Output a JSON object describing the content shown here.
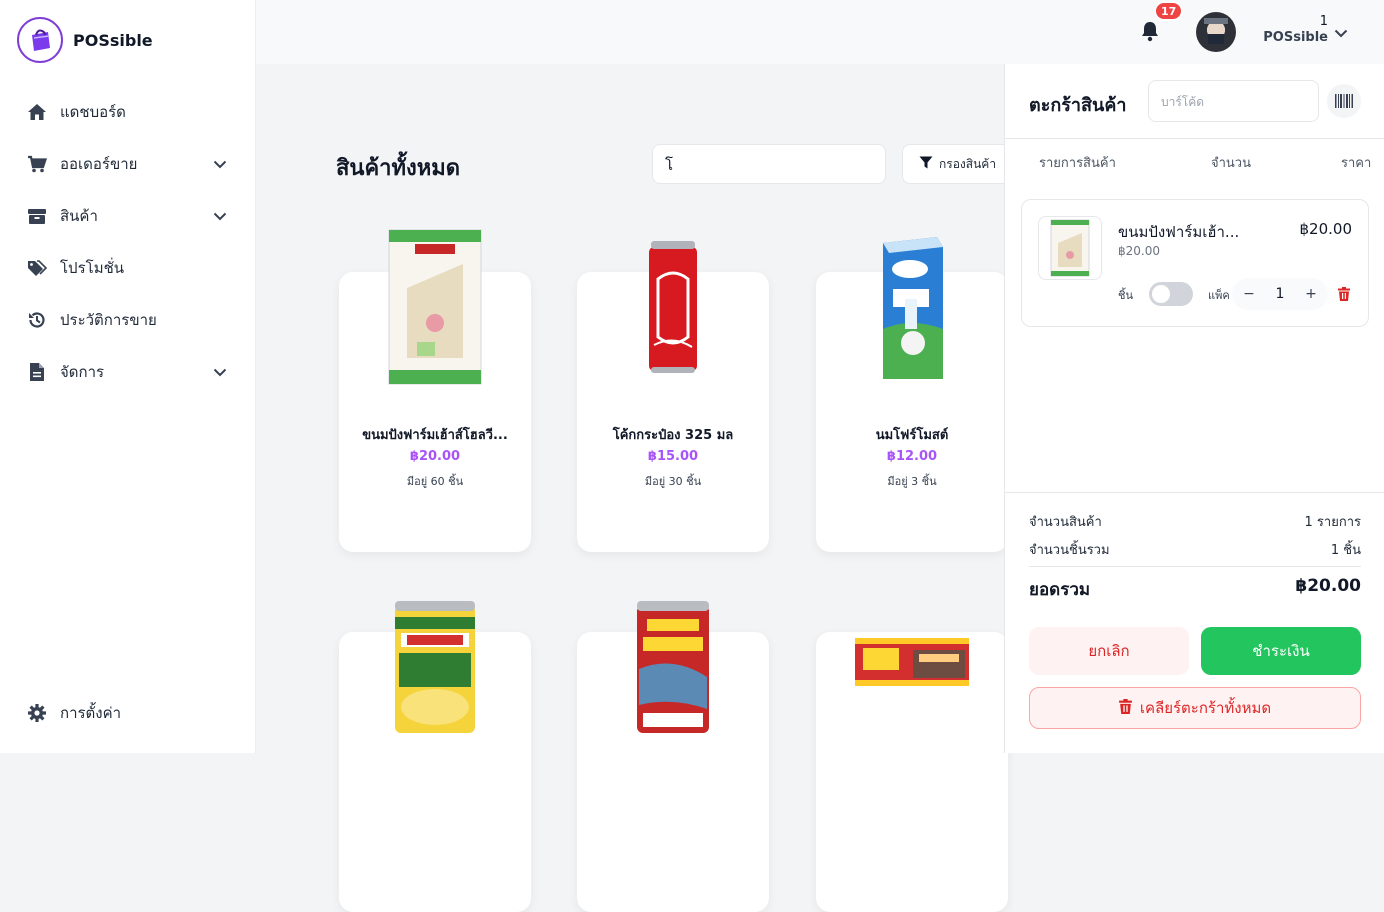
{
  "brand": {
    "name": "POSsible"
  },
  "sidebar": {
    "items": [
      {
        "label": "แดชบอร์ด",
        "icon": "home-icon"
      },
      {
        "label": "ออเดอร์ขาย",
        "icon": "cart-icon"
      },
      {
        "label": "สินค้า",
        "icon": "box-icon"
      },
      {
        "label": "โปรโมชั่น",
        "icon": "tags-icon"
      },
      {
        "label": "ประวัติการขาย",
        "icon": "history-icon"
      },
      {
        "label": "จัดการ",
        "icon": "file-icon"
      }
    ],
    "settings_label": "การตั้งค่า"
  },
  "header": {
    "notification_count": "17",
    "user_id": "1",
    "user_name": "POSsible"
  },
  "main": {
    "title": "สินค้าทั้งหมด",
    "search_value": "โ",
    "filter_label": "กรองสินค้า",
    "products": [
      {
        "name": "ขนมปังฟาร์มเฮ้าส์โฮลวี...",
        "price": "฿20.00",
        "stock": "มีอยู่ 60 ชิ้น"
      },
      {
        "name": "โค้กกระป๋อง 325 มล",
        "price": "฿15.00",
        "stock": "มีอยู่ 30 ชิ้น"
      },
      {
        "name": "นมโฟร์โมสต์",
        "price": "฿12.00",
        "stock": "มีอยู่ 3 ชิ้น"
      },
      {
        "name": "",
        "price": "",
        "stock": ""
      },
      {
        "name": "",
        "price": "",
        "stock": ""
      },
      {
        "name": "",
        "price": "",
        "stock": ""
      }
    ]
  },
  "cart": {
    "title": "ตะกร้าสินค้า",
    "barcode_placeholder": "บาร์โค้ด",
    "col_item": "รายการสินค้า",
    "col_qty": "จำนวน",
    "col_price": "ราคา",
    "item": {
      "name": "ขนมปังฟาร์มเฮ้า...",
      "total": "฿20.00",
      "unit_price": "฿20.00",
      "piece_label": "ชิ้น",
      "pack_label": "แพ็ค",
      "qty": "1",
      "minus": "−",
      "plus": "+"
    },
    "summary": {
      "count_label": "จำนวนสินค้า",
      "count_value": "1 รายการ",
      "pieces_label": "จำนวนชิ้นรวม",
      "pieces_value": "1 ชิ้น",
      "total_label": "ยอดรวม",
      "total_value": "฿20.00"
    },
    "cancel_label": "ยกเลิก",
    "pay_label": "ชำระเงิน",
    "clear_label": "เคลียร์ตะกร้าทั้งหมด"
  },
  "colors": {
    "accent": "#a855f7",
    "pay": "#22c55e",
    "danger": "#dc2626",
    "brand": "#7e3fd4"
  }
}
